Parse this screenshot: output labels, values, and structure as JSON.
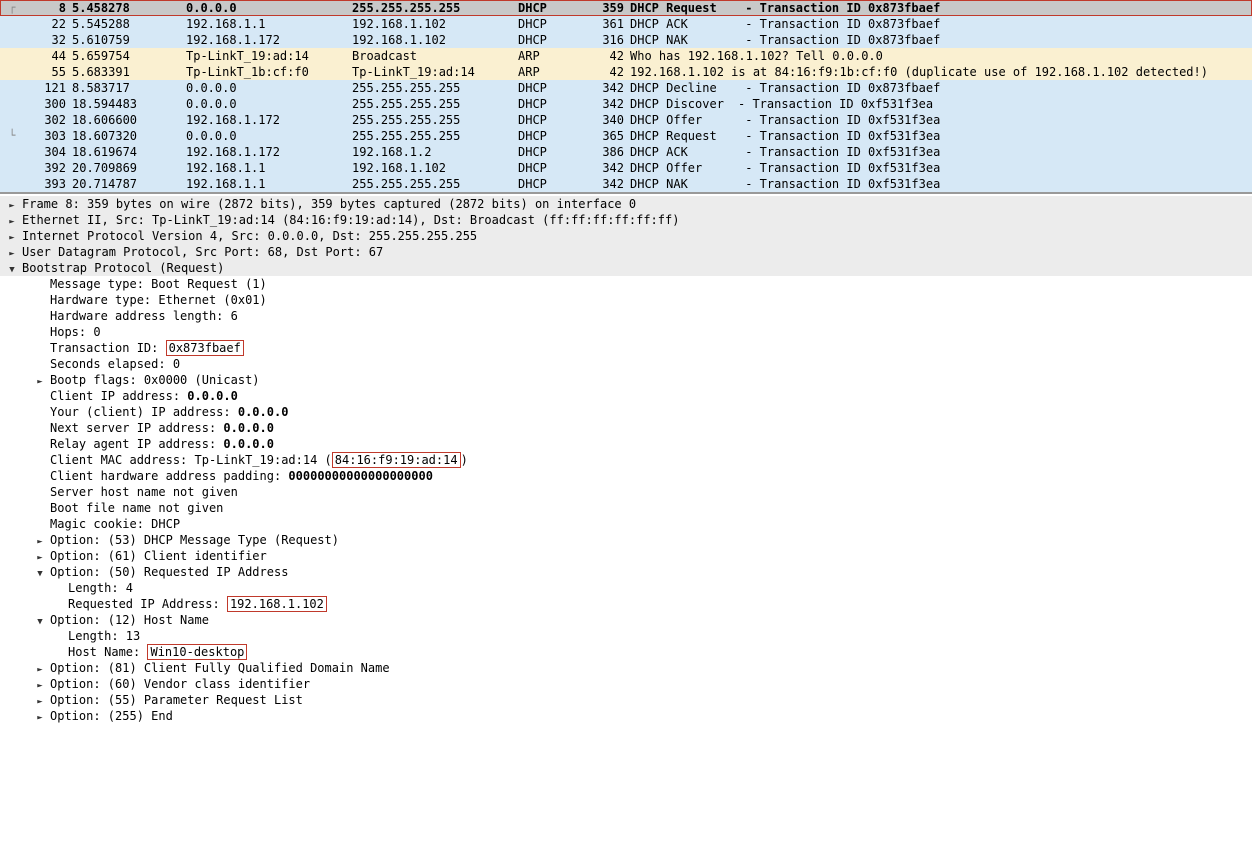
{
  "packets": [
    {
      "tree": "┌",
      "no": "8",
      "time": "5.458278",
      "src": "0.0.0.0",
      "dst": "255.255.255.255",
      "proto": "DHCP",
      "len": "359",
      "info1": "DHCP Request",
      "info2": " - Transaction ID 0x873fbaef",
      "bg": "selected",
      "bold": true,
      "redbox": true
    },
    {
      "tree": "",
      "no": "22",
      "time": "5.545288",
      "src": "192.168.1.1",
      "dst": "192.168.1.102",
      "proto": "DHCP",
      "len": "361",
      "info1": "DHCP ACK",
      "info2": "    - Transaction ID 0x873fbaef",
      "bg": "bg-blue"
    },
    {
      "tree": "",
      "no": "32",
      "time": "5.610759",
      "src": "192.168.1.172",
      "dst": "192.168.1.102",
      "proto": "DHCP",
      "len": "316",
      "info1": "DHCP NAK",
      "info2": "    - Transaction ID 0x873fbaef",
      "bg": "bg-blue"
    },
    {
      "tree": "",
      "no": "44",
      "time": "5.659754",
      "src": "Tp-LinkT_19:ad:14",
      "dst": "Broadcast",
      "proto": "ARP",
      "len": "42",
      "info1": "",
      "info2": "Who has 192.168.1.102? Tell 0.0.0.0",
      "bg": "bg-tan"
    },
    {
      "tree": "",
      "no": "55",
      "time": "5.683391",
      "src": "Tp-LinkT_1b:cf:f0",
      "dst": "Tp-LinkT_19:ad:14",
      "proto": "ARP",
      "len": "42",
      "info1": "",
      "info2": "192.168.1.102 is at 84:16:f9:1b:cf:f0 (duplicate use of 192.168.1.102 detected!)",
      "bg": "bg-tan"
    },
    {
      "tree": "",
      "no": "121",
      "time": "8.583717",
      "src": "0.0.0.0",
      "dst": "255.255.255.255",
      "proto": "DHCP",
      "len": "342",
      "info1": "DHCP Decline",
      "info2": " - Transaction ID 0x873fbaef",
      "bg": "bg-blue"
    },
    {
      "tree": "",
      "no": "300",
      "time": "18.594483",
      "src": "0.0.0.0",
      "dst": "255.255.255.255",
      "proto": "DHCP",
      "len": "342",
      "info1": "DHCP Discover",
      "info2": "- Transaction ID 0xf531f3ea",
      "bg": "bg-blue"
    },
    {
      "tree": "",
      "no": "302",
      "time": "18.606600",
      "src": "192.168.1.172",
      "dst": "255.255.255.255",
      "proto": "DHCP",
      "len": "340",
      "info1": "DHCP Offer",
      "info2": "   - Transaction ID 0xf531f3ea",
      "bg": "bg-blue"
    },
    {
      "tree": "└",
      "no": "303",
      "time": "18.607320",
      "src": "0.0.0.0",
      "dst": "255.255.255.255",
      "proto": "DHCP",
      "len": "365",
      "info1": "DHCP Request",
      "info2": " - Transaction ID 0xf531f3ea",
      "bg": "bg-blue"
    },
    {
      "tree": "",
      "no": "304",
      "time": "18.619674",
      "src": "192.168.1.172",
      "dst": "192.168.1.2",
      "proto": "DHCP",
      "len": "386",
      "info1": "DHCP ACK",
      "info2": "    - Transaction ID 0xf531f3ea",
      "bg": "bg-blue"
    },
    {
      "tree": "",
      "no": "392",
      "time": "20.709869",
      "src": "192.168.1.1",
      "dst": "192.168.1.102",
      "proto": "DHCP",
      "len": "342",
      "info1": "DHCP Offer",
      "info2": "   - Transaction ID 0xf531f3ea",
      "bg": "bg-blue"
    },
    {
      "tree": "",
      "no": "393",
      "time": "20.714787",
      "src": "192.168.1.1",
      "dst": "255.255.255.255",
      "proto": "DHCP",
      "len": "342",
      "info1": "DHCP NAK",
      "info2": "    - Transaction ID 0xf531f3ea",
      "bg": "bg-blue"
    }
  ],
  "details": [
    {
      "exp": "►",
      "indent": 0,
      "header": true,
      "pre": "Frame 8: 359 bytes on wire (2872 bits), 359 bytes captured (2872 bits) on interface 0"
    },
    {
      "exp": "►",
      "indent": 0,
      "header": true,
      "pre": "Ethernet II, Src: Tp-LinkT_19:ad:14 (84:16:f9:19:ad:14), Dst: Broadcast (ff:ff:ff:ff:ff:ff)"
    },
    {
      "exp": "►",
      "indent": 0,
      "header": true,
      "pre": "Internet Protocol Version 4, Src: 0.0.0.0, Dst: 255.255.255.255"
    },
    {
      "exp": "►",
      "indent": 0,
      "header": true,
      "pre": "User Datagram Protocol, Src Port: 68, Dst Port: 67"
    },
    {
      "exp": "▼",
      "indent": 0,
      "header": true,
      "pre": "Bootstrap Protocol (Request)"
    },
    {
      "exp": "",
      "indent": 1,
      "pre": "Message type: Boot Request (1)"
    },
    {
      "exp": "",
      "indent": 1,
      "pre": "Hardware type: Ethernet (0x01)"
    },
    {
      "exp": "",
      "indent": 1,
      "pre": "Hardware address length: 6"
    },
    {
      "exp": "",
      "indent": 1,
      "pre": "Hops: 0"
    },
    {
      "exp": "",
      "indent": 1,
      "pre": "Transaction ID: ",
      "redboxText": "0x873fbaef"
    },
    {
      "exp": "",
      "indent": 1,
      "pre": "Seconds elapsed: 0"
    },
    {
      "exp": "►",
      "indent": 1,
      "pre": "Bootp flags: 0x0000 (Unicast)"
    },
    {
      "exp": "",
      "indent": 1,
      "pre": "Client IP address: ",
      "bold": "0.0.0.0"
    },
    {
      "exp": "",
      "indent": 1,
      "pre": "Your (client) IP address: ",
      "bold": "0.0.0.0"
    },
    {
      "exp": "",
      "indent": 1,
      "pre": "Next server IP address: ",
      "bold": "0.0.0.0"
    },
    {
      "exp": "",
      "indent": 1,
      "pre": "Relay agent IP address: ",
      "bold": "0.0.0.0"
    },
    {
      "exp": "",
      "indent": 1,
      "pre": "Client MAC address: Tp-LinkT_19:ad:14 (",
      "redboxText": "84:16:f9:19:ad:14",
      "post": ")"
    },
    {
      "exp": "",
      "indent": 1,
      "pre": "Client hardware address padding: ",
      "bold": "00000000000000000000"
    },
    {
      "exp": "",
      "indent": 1,
      "pre": "Server host name not given"
    },
    {
      "exp": "",
      "indent": 1,
      "pre": "Boot file name not given"
    },
    {
      "exp": "",
      "indent": 1,
      "pre": "Magic cookie: DHCP"
    },
    {
      "exp": "►",
      "indent": 1,
      "pre": "Option: (53) DHCP Message Type (Request)"
    },
    {
      "exp": "►",
      "indent": 1,
      "pre": "Option: (61) Client identifier"
    },
    {
      "exp": "▼",
      "indent": 1,
      "pre": "Option: (50) Requested IP Address"
    },
    {
      "exp": "",
      "indent": 2,
      "pre": "Length: 4"
    },
    {
      "exp": "",
      "indent": 2,
      "pre": "Requested IP Address: ",
      "redboxText": "192.168.1.102"
    },
    {
      "exp": "▼",
      "indent": 1,
      "pre": "Option: (12) Host Name"
    },
    {
      "exp": "",
      "indent": 2,
      "pre": "Length: 13"
    },
    {
      "exp": "",
      "indent": 2,
      "pre": "Host Name: ",
      "redboxText": "Win10-desktop"
    },
    {
      "exp": "►",
      "indent": 1,
      "pre": "Option: (81) Client Fully Qualified Domain Name"
    },
    {
      "exp": "►",
      "indent": 1,
      "pre": "Option: (60) Vendor class identifier"
    },
    {
      "exp": "►",
      "indent": 1,
      "pre": "Option: (55) Parameter Request List"
    },
    {
      "exp": "►",
      "indent": 1,
      "pre": "Option: (255) End"
    }
  ]
}
